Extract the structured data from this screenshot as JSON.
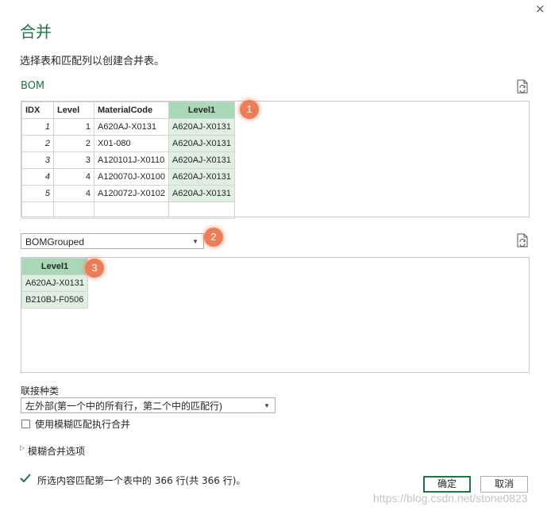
{
  "dialog": {
    "title": "合并",
    "subtitle": "选择表和匹配列以创建合并表。",
    "close_glyph": "×"
  },
  "table1": {
    "label": "BOM",
    "columns": [
      "IDX",
      "Level",
      "MaterialCode",
      "Level1"
    ],
    "rows": [
      [
        "1",
        "1",
        "A620AJ-X0131",
        "A620AJ-X0131"
      ],
      [
        "2",
        "2",
        "X01-080",
        "A620AJ-X0131"
      ],
      [
        "3",
        "3",
        "A120101J-X0110",
        "A620AJ-X0131"
      ],
      [
        "4",
        "4",
        "A120070J-X0100",
        "A620AJ-X0131"
      ],
      [
        "5",
        "4",
        "A120072J-X0102",
        "A620AJ-X0131"
      ]
    ]
  },
  "table2": {
    "selected": "BOMGrouped",
    "columns": [
      "Level1"
    ],
    "rows": [
      [
        "A620AJ-X0131"
      ],
      [
        "B210BJ-F0506"
      ]
    ]
  },
  "badges": [
    "1",
    "2",
    "3"
  ],
  "join": {
    "label": "联接种类",
    "selected": "左外部(第一个中的所有行，第二个中的匹配行)"
  },
  "fuzzy": {
    "checkbox_label": "使用模糊匹配执行合并",
    "options_label": "模糊合并选项"
  },
  "status": "所选内容匹配第一个表中的 366 行(共 366 行)。",
  "buttons": {
    "ok": "确定",
    "cancel": "取消"
  },
  "watermark": "https://blog.csdn.net/stone0823",
  "colors": {
    "accent": "#217346",
    "badge": "#ed7d57",
    "selected_header": "#a9d8b8",
    "selected_cell": "#dff0e3"
  }
}
